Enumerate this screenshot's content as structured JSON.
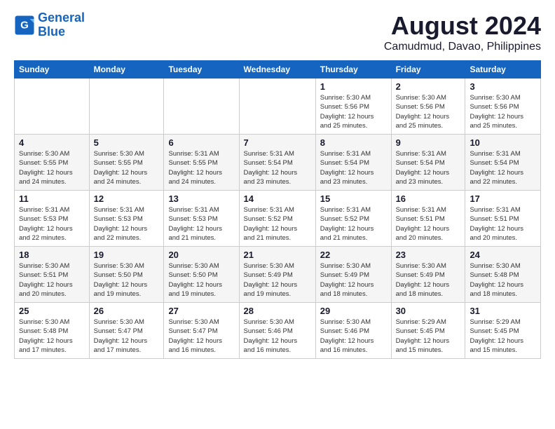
{
  "logo": {
    "line1": "General",
    "line2": "Blue"
  },
  "title": "August 2024",
  "subtitle": "Camudmud, Davao, Philippines",
  "days_header": [
    "Sunday",
    "Monday",
    "Tuesday",
    "Wednesday",
    "Thursday",
    "Friday",
    "Saturday"
  ],
  "weeks": [
    [
      {
        "day": "",
        "info": ""
      },
      {
        "day": "",
        "info": ""
      },
      {
        "day": "",
        "info": ""
      },
      {
        "day": "",
        "info": ""
      },
      {
        "day": "1",
        "info": "Sunrise: 5:30 AM\nSunset: 5:56 PM\nDaylight: 12 hours\nand 25 minutes."
      },
      {
        "day": "2",
        "info": "Sunrise: 5:30 AM\nSunset: 5:56 PM\nDaylight: 12 hours\nand 25 minutes."
      },
      {
        "day": "3",
        "info": "Sunrise: 5:30 AM\nSunset: 5:56 PM\nDaylight: 12 hours\nand 25 minutes."
      }
    ],
    [
      {
        "day": "4",
        "info": "Sunrise: 5:30 AM\nSunset: 5:55 PM\nDaylight: 12 hours\nand 24 minutes."
      },
      {
        "day": "5",
        "info": "Sunrise: 5:30 AM\nSunset: 5:55 PM\nDaylight: 12 hours\nand 24 minutes."
      },
      {
        "day": "6",
        "info": "Sunrise: 5:31 AM\nSunset: 5:55 PM\nDaylight: 12 hours\nand 24 minutes."
      },
      {
        "day": "7",
        "info": "Sunrise: 5:31 AM\nSunset: 5:54 PM\nDaylight: 12 hours\nand 23 minutes."
      },
      {
        "day": "8",
        "info": "Sunrise: 5:31 AM\nSunset: 5:54 PM\nDaylight: 12 hours\nand 23 minutes."
      },
      {
        "day": "9",
        "info": "Sunrise: 5:31 AM\nSunset: 5:54 PM\nDaylight: 12 hours\nand 23 minutes."
      },
      {
        "day": "10",
        "info": "Sunrise: 5:31 AM\nSunset: 5:54 PM\nDaylight: 12 hours\nand 22 minutes."
      }
    ],
    [
      {
        "day": "11",
        "info": "Sunrise: 5:31 AM\nSunset: 5:53 PM\nDaylight: 12 hours\nand 22 minutes."
      },
      {
        "day": "12",
        "info": "Sunrise: 5:31 AM\nSunset: 5:53 PM\nDaylight: 12 hours\nand 22 minutes."
      },
      {
        "day": "13",
        "info": "Sunrise: 5:31 AM\nSunset: 5:53 PM\nDaylight: 12 hours\nand 21 minutes."
      },
      {
        "day": "14",
        "info": "Sunrise: 5:31 AM\nSunset: 5:52 PM\nDaylight: 12 hours\nand 21 minutes."
      },
      {
        "day": "15",
        "info": "Sunrise: 5:31 AM\nSunset: 5:52 PM\nDaylight: 12 hours\nand 21 minutes."
      },
      {
        "day": "16",
        "info": "Sunrise: 5:31 AM\nSunset: 5:51 PM\nDaylight: 12 hours\nand 20 minutes."
      },
      {
        "day": "17",
        "info": "Sunrise: 5:31 AM\nSunset: 5:51 PM\nDaylight: 12 hours\nand 20 minutes."
      }
    ],
    [
      {
        "day": "18",
        "info": "Sunrise: 5:30 AM\nSunset: 5:51 PM\nDaylight: 12 hours\nand 20 minutes."
      },
      {
        "day": "19",
        "info": "Sunrise: 5:30 AM\nSunset: 5:50 PM\nDaylight: 12 hours\nand 19 minutes."
      },
      {
        "day": "20",
        "info": "Sunrise: 5:30 AM\nSunset: 5:50 PM\nDaylight: 12 hours\nand 19 minutes."
      },
      {
        "day": "21",
        "info": "Sunrise: 5:30 AM\nSunset: 5:49 PM\nDaylight: 12 hours\nand 19 minutes."
      },
      {
        "day": "22",
        "info": "Sunrise: 5:30 AM\nSunset: 5:49 PM\nDaylight: 12 hours\nand 18 minutes."
      },
      {
        "day": "23",
        "info": "Sunrise: 5:30 AM\nSunset: 5:49 PM\nDaylight: 12 hours\nand 18 minutes."
      },
      {
        "day": "24",
        "info": "Sunrise: 5:30 AM\nSunset: 5:48 PM\nDaylight: 12 hours\nand 18 minutes."
      }
    ],
    [
      {
        "day": "25",
        "info": "Sunrise: 5:30 AM\nSunset: 5:48 PM\nDaylight: 12 hours\nand 17 minutes."
      },
      {
        "day": "26",
        "info": "Sunrise: 5:30 AM\nSunset: 5:47 PM\nDaylight: 12 hours\nand 17 minutes."
      },
      {
        "day": "27",
        "info": "Sunrise: 5:30 AM\nSunset: 5:47 PM\nDaylight: 12 hours\nand 16 minutes."
      },
      {
        "day": "28",
        "info": "Sunrise: 5:30 AM\nSunset: 5:46 PM\nDaylight: 12 hours\nand 16 minutes."
      },
      {
        "day": "29",
        "info": "Sunrise: 5:30 AM\nSunset: 5:46 PM\nDaylight: 12 hours\nand 16 minutes."
      },
      {
        "day": "30",
        "info": "Sunrise: 5:29 AM\nSunset: 5:45 PM\nDaylight: 12 hours\nand 15 minutes."
      },
      {
        "day": "31",
        "info": "Sunrise: 5:29 AM\nSunset: 5:45 PM\nDaylight: 12 hours\nand 15 minutes."
      }
    ]
  ]
}
